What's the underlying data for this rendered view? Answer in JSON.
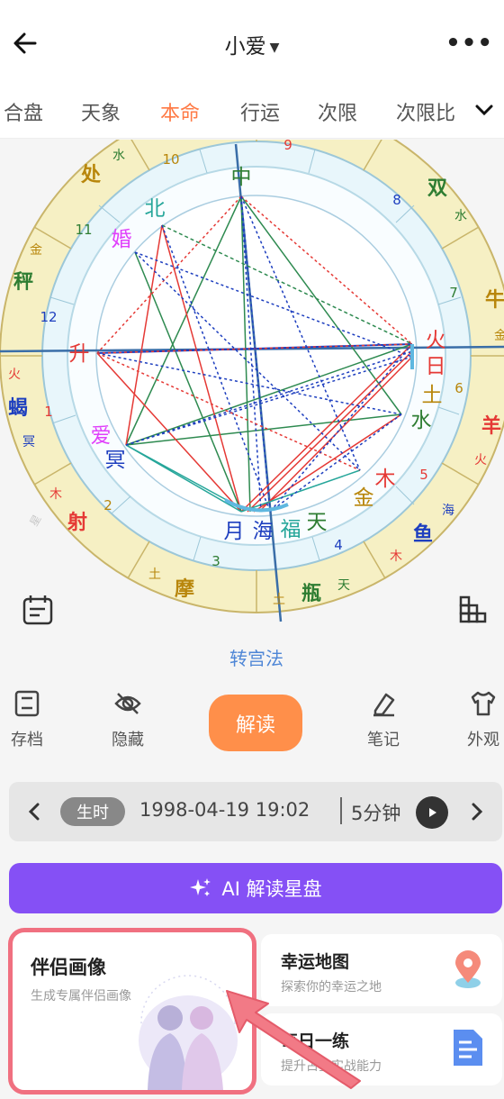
{
  "header": {
    "title": "小爱",
    "more": "•••"
  },
  "tabs": [
    "合盘",
    "天象",
    "本命",
    "行运",
    "次限",
    "次限比"
  ],
  "active_tab": "本命",
  "chart": {
    "signs": [
      "处",
      "双",
      "秤",
      "牛",
      "蝎",
      "羊",
      "射",
      "鱼",
      "摩",
      "瓶"
    ],
    "planets": [
      "中",
      "北",
      "婚",
      "升",
      "火",
      "日",
      "土",
      "水",
      "爱",
      "冥",
      "木",
      "金",
      "月",
      "海",
      "福",
      "天"
    ],
    "house_numbers": [
      "9",
      "10",
      "11",
      "12",
      "1",
      "2",
      "3",
      "4",
      "5",
      "6",
      "7",
      "8"
    ],
    "ruler_glyphs": [
      "水",
      "水",
      "金",
      "金",
      "火",
      "火",
      "冥",
      "木",
      "木",
      "海",
      "土",
      "土",
      "天"
    ]
  },
  "turn_link": "转宫法",
  "toolbar": {
    "save": "存档",
    "hide": "隐藏",
    "interpret": "解读",
    "notes": "笔记",
    "appearance": "外观"
  },
  "time_bar": {
    "chip": "生时",
    "datetime": "1998-04-19 19:02",
    "step": "5分钟"
  },
  "ai_button": "AI 解读星盘",
  "cards": {
    "partner": {
      "title": "伴侣画像",
      "subtitle": "生成专属伴侣画像"
    },
    "lucky_map": {
      "title": "幸运地图",
      "subtitle": "探索你的幸运之地"
    },
    "daily": {
      "title": "每日一练",
      "subtitle": "提升占星实战能力"
    }
  },
  "colors": {
    "accent_orange": "#ff7a45",
    "interpret_button": "#ff8f4a",
    "ai_purple": "#8550f5",
    "link_blue": "#4e86d6",
    "highlight_pink": "#f07080"
  }
}
